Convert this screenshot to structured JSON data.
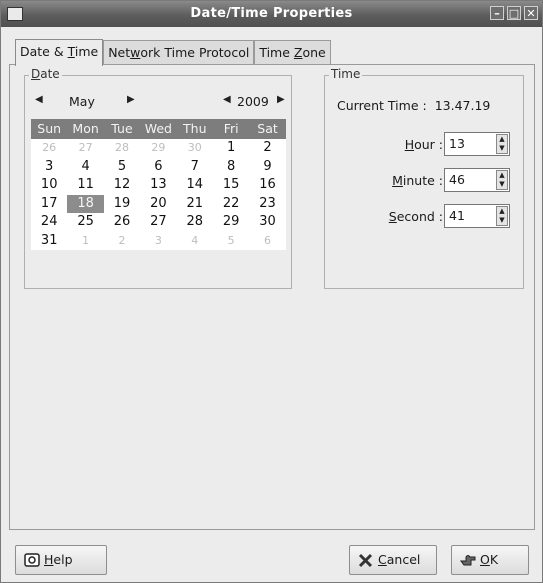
{
  "window": {
    "title": "Date/Time Properties"
  },
  "tabs": [
    {
      "pre": "Date & ",
      "u": "T",
      "post": "ime"
    },
    {
      "pre": "Net",
      "u": "w",
      "post": "ork Time Protocol"
    },
    {
      "pre": "Time ",
      "u": "Z",
      "post": "one"
    }
  ],
  "date": {
    "frame_pre": "",
    "frame_u": "D",
    "frame_post": "ate",
    "month": "May",
    "year": "2009",
    "weekdays": [
      "Sun",
      "Mon",
      "Tue",
      "Wed",
      "Thu",
      "Fri",
      "Sat"
    ],
    "days": [
      [
        "26",
        "27",
        "28",
        "29",
        "30",
        "1",
        "2"
      ],
      [
        "3",
        "4",
        "5",
        "6",
        "7",
        "8",
        "9"
      ],
      [
        "10",
        "11",
        "12",
        "13",
        "14",
        "15",
        "16"
      ],
      [
        "17",
        "18",
        "19",
        "20",
        "21",
        "22",
        "23"
      ],
      [
        "24",
        "25",
        "26",
        "27",
        "28",
        "29",
        "30"
      ],
      [
        "31",
        "1",
        "2",
        "3",
        "4",
        "5",
        "6"
      ]
    ],
    "selected_day": "18"
  },
  "time": {
    "frame_label": "Time",
    "current_label": "Current Time :",
    "current_value": "13.47.19",
    "hour_pre": "",
    "hour_u": "H",
    "hour_post": "our :",
    "hour_value": "13",
    "minute_pre": "",
    "minute_u": "M",
    "minute_post": "inute :",
    "minute_value": "46",
    "second_pre": "",
    "second_u": "S",
    "second_post": "econd :",
    "second_value": "41"
  },
  "buttons": {
    "help_pre": "",
    "help_u": "H",
    "help_post": "elp",
    "cancel_pre": "",
    "cancel_u": "C",
    "cancel_post": "ancel",
    "ok_pre": "",
    "ok_u": "O",
    "ok_post": "K"
  }
}
